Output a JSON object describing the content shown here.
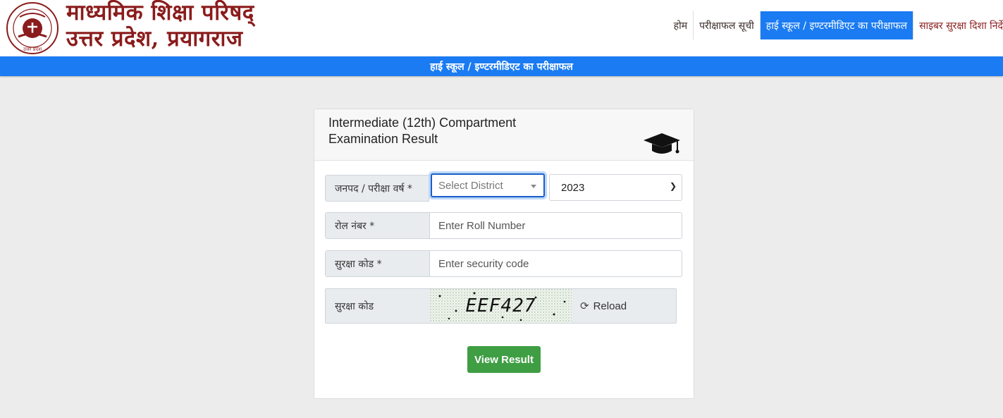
{
  "header": {
    "org_title_line1": "माध्यमिक शिक्षा परिषद्",
    "org_title_line2": "उत्तर प्रदेश, प्रयागराज",
    "logo_text": "उत्तर प्रदेश",
    "nav": [
      {
        "label": "होम",
        "active": false
      },
      {
        "label": "परीक्षाफल सूची",
        "active": false
      },
      {
        "label": "हाई स्कूल / इण्टरमीडिएट का परीक्षाफल",
        "active": true
      },
      {
        "label": "साइबर सुरक्षा दिशा निर्दे",
        "active": false
      }
    ]
  },
  "banner": {
    "title": "हाई स्कूल / इण्टरमीडिएट का परीक्षाफल"
  },
  "form": {
    "title_line1": "Intermediate (12th) Compartment",
    "title_line2": "Examination Result",
    "district_label": "जनपद / परीक्षा वर्ष *",
    "district_placeholder": "Select District",
    "year_value": "2023",
    "roll_label": "रोल नंबर *",
    "roll_placeholder": "Enter Roll Number",
    "security_label": "सुरक्षा कोड *",
    "security_placeholder": "Enter security code",
    "captcha_label": "सुरक्षा कोड",
    "captcha_text": "EEF427",
    "reload_label": "Reload",
    "submit_label": "View Result"
  },
  "colors": {
    "brand_red": "#8b1c1c",
    "nav_active": "#1a7bf2",
    "banner_blue": "#1a7bf2",
    "button_green": "#3f9e43"
  },
  "icons": [
    "logo-emblem",
    "graduation-cap-icon",
    "reload-icon",
    "dropdown-arrow-icon"
  ]
}
